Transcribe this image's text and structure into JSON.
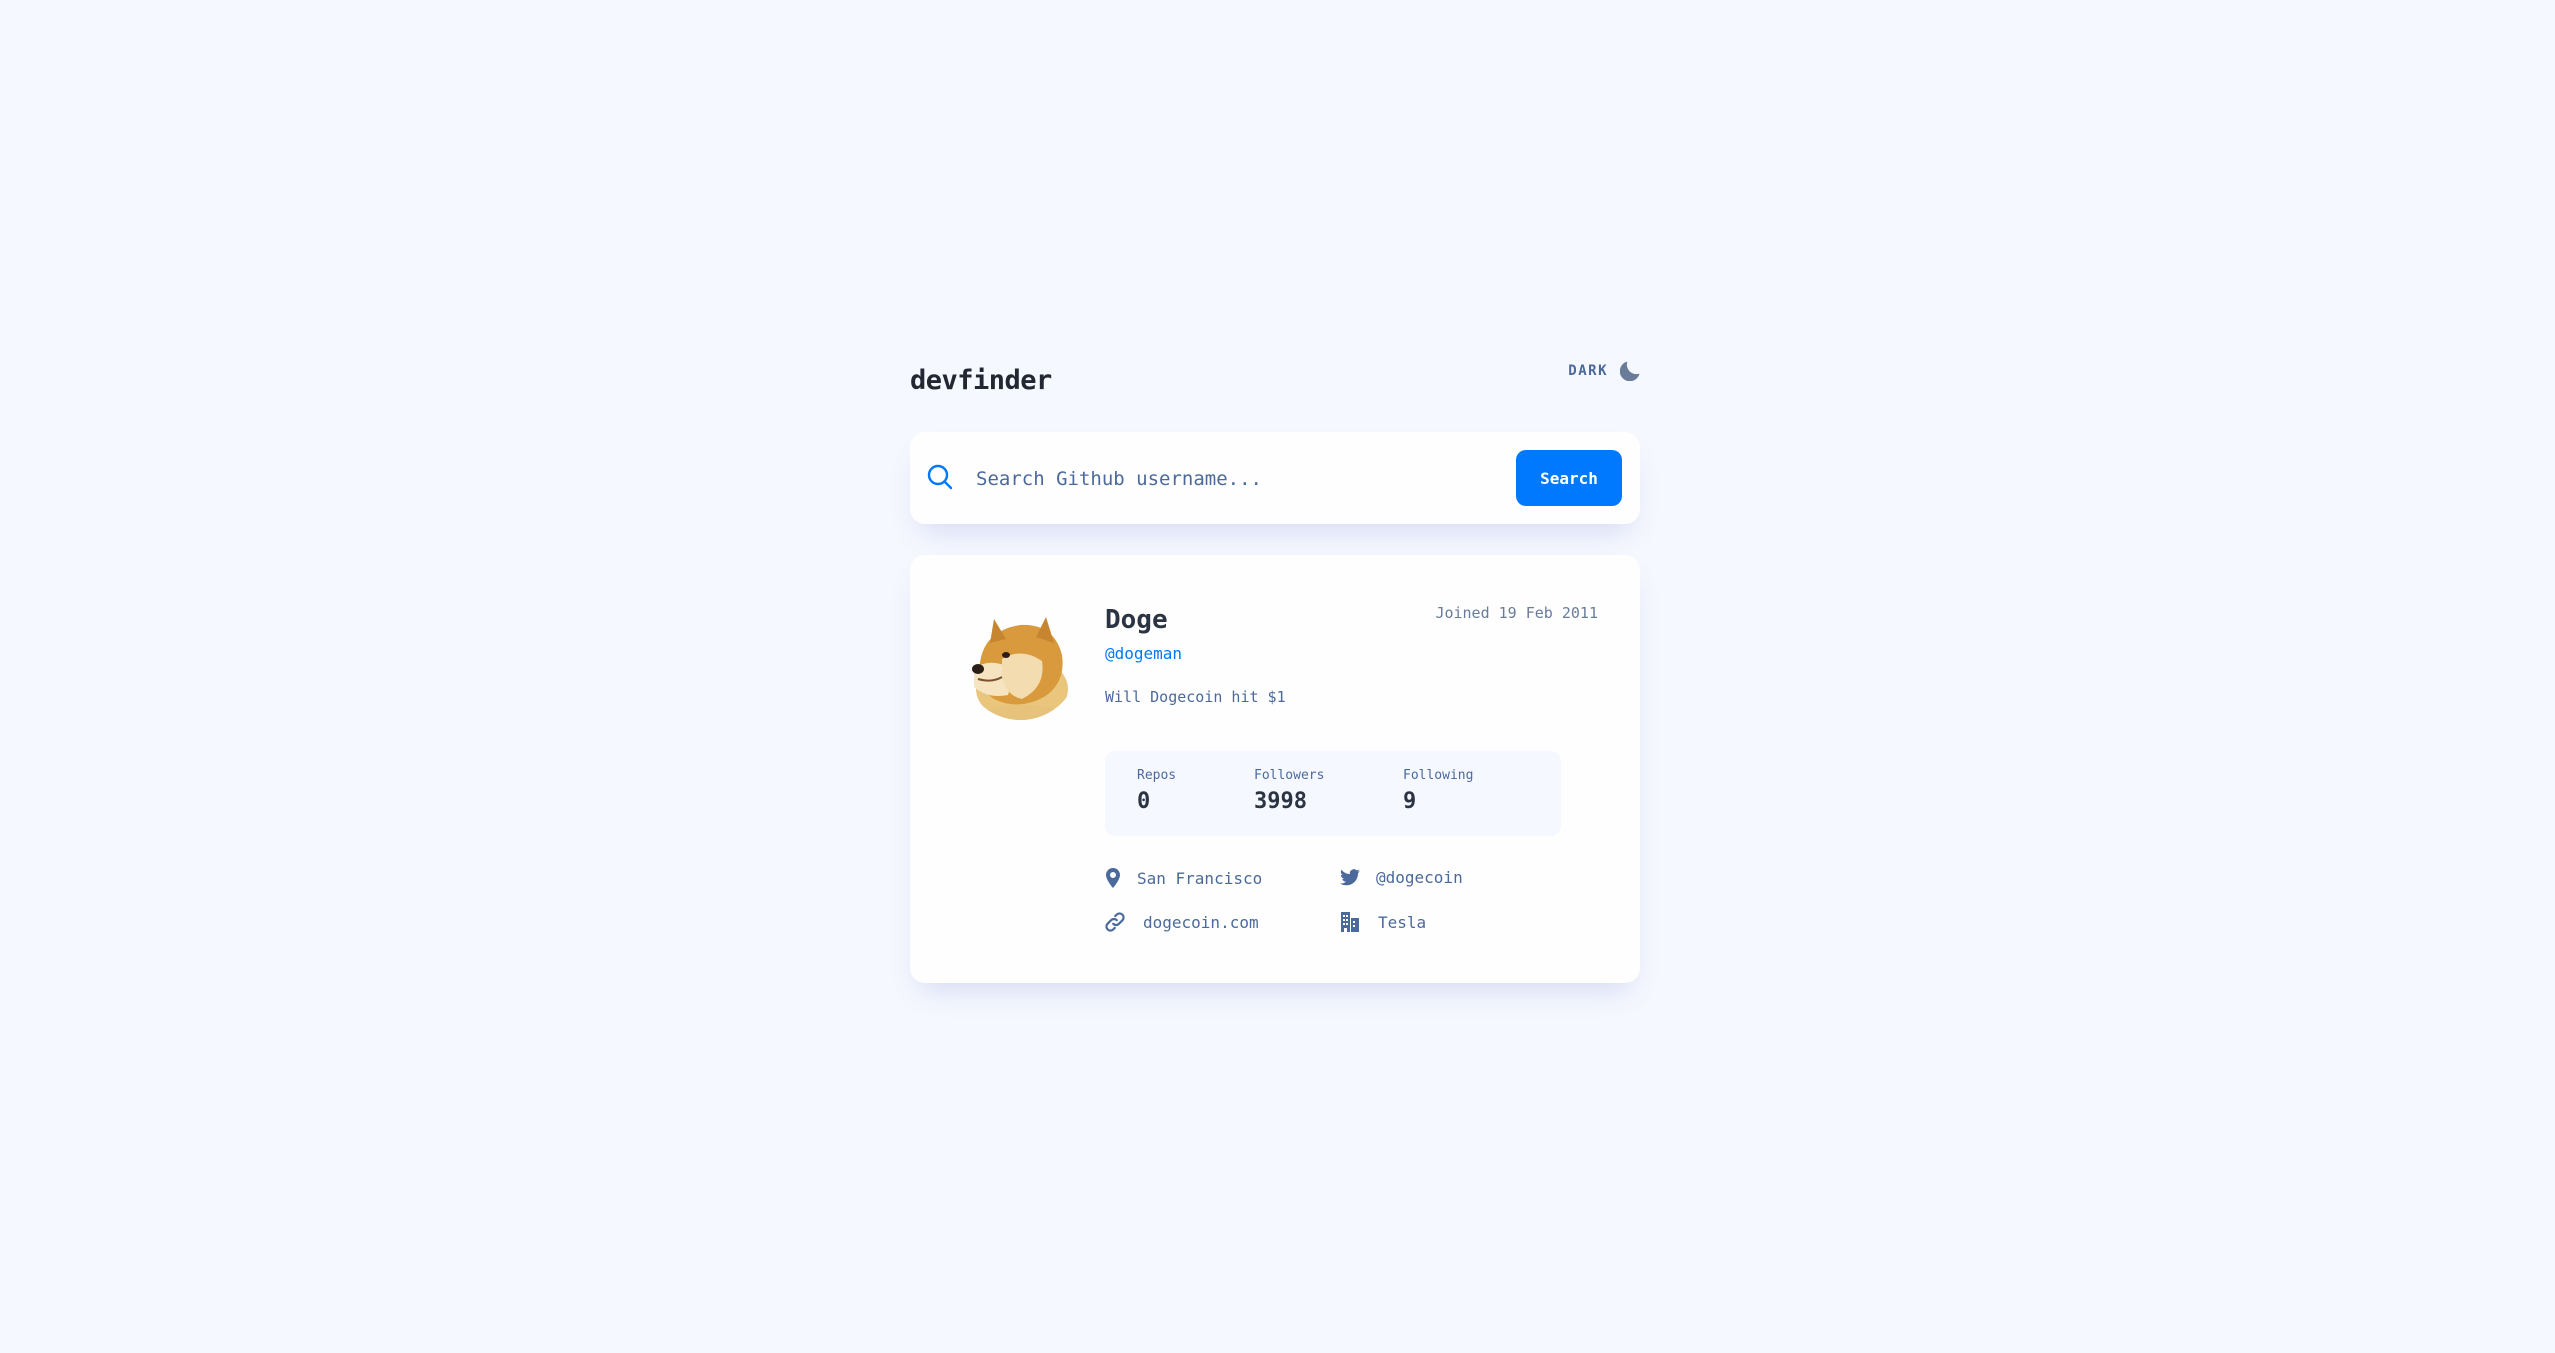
{
  "header": {
    "logo": "devfinder",
    "theme_label": "DARK",
    "theme_icon": "moon-icon"
  },
  "search": {
    "placeholder": "Search Github username...",
    "value": "",
    "button_label": "Search",
    "icon": "search-icon"
  },
  "profile": {
    "name": "Doge",
    "login": "@dogeman",
    "joined": "Joined 19 Feb 2011",
    "bio": "Will Dogecoin hit $1",
    "avatar_alt": "Doge avatar"
  },
  "stats": {
    "repos_label": "Repos",
    "repos_value": "0",
    "followers_label": "Followers",
    "followers_value": "3998",
    "following_label": "Following",
    "following_value": "9"
  },
  "links": {
    "location": "San Francisco",
    "twitter": "@dogecoin",
    "blog": "dogecoin.com",
    "company": "Tesla"
  },
  "colors": {
    "background": "#f6f8ff",
    "card": "#fefefe",
    "accent": "#0079ff",
    "text": "#4b6a9b",
    "heading": "#2b3442"
  }
}
